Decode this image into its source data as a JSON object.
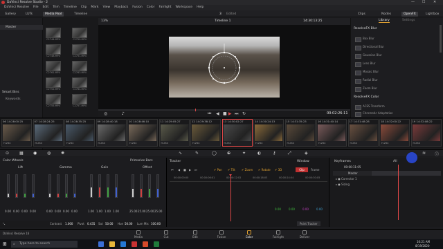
{
  "window": {
    "title": "DaVinci Resolve Studio - 2",
    "min": "—",
    "max": "☐",
    "close": "✕"
  },
  "menu": [
    "DaVinci Resolve",
    "File",
    "Edit",
    "Trim",
    "Timeline",
    "Clip",
    "Mark",
    "View",
    "Playback",
    "Fusion",
    "Color",
    "Fairlight",
    "Workspace",
    "Help"
  ],
  "toolbar": {
    "gallery": "Gallery",
    "luts": "LUTs",
    "media_pool": "Media Pool",
    "timeline": "Timeline",
    "project_num": "3",
    "project_status": "Edited",
    "clips": "Clips",
    "nodes": "Nodes",
    "openfx": "OpenFX",
    "lightbox": "Lightbox"
  },
  "left_panel": {
    "master": "Master",
    "smart_bins": "Smart Bins",
    "keywords": "Keywords"
  },
  "media_thumbs": [
    "C2744.MP4",
    "C2750.MP4",
    "C2748.MP4",
    "C2751.MP4",
    "C2761.MP4",
    "C2763.MP4",
    "C2752.MP4",
    "C2764.MP4",
    "C2755.MP4",
    "C2757.MP4"
  ],
  "viewer": {
    "zoom": "13%",
    "timeline_name": "Timeline 1",
    "timecode": "14:30:13:25",
    "playhead_tc": "00:02:26:11"
  },
  "library": {
    "tab_library": "Library",
    "tab_settings": "Settings",
    "blur_header": "ResolveFX Blur",
    "blur_items": [
      "Box Blur",
      "Directional Blur",
      "Gaussian Blur",
      "Lens Blur",
      "Mosaic Blur",
      "Radial Blur",
      "Zoom Blur"
    ],
    "color_header": "ResolveFX Color",
    "color_items": [
      "ACES Transform",
      "Chromatic Adaptation"
    ]
  },
  "clips": [
    {
      "num": "06",
      "tc": "14:28:00:25",
      "codec": "H.264",
      "color": "#6a5a4a"
    },
    {
      "num": "07",
      "tc": "14:28:24:25",
      "codec": "H.264",
      "color": "#5a6a7a"
    },
    {
      "num": "08",
      "tc": "14:28:35:25",
      "codec": "H.264",
      "color": "#4a5a6a"
    },
    {
      "num": "09",
      "tc": "14:28:40:18",
      "codec": "H.264",
      "color": "#6a6a6a"
    },
    {
      "num": "10",
      "tc": "14:28:46:10",
      "codec": "H.264",
      "color": "#7a6a5a"
    },
    {
      "num": "11",
      "tc": "14:29:05:27",
      "codec": "H.264",
      "color": "#5a5a4a"
    },
    {
      "num": "12",
      "tc": "14:29:38:12",
      "codec": "H.264",
      "color": "#6a5a3a"
    },
    {
      "num": "13",
      "tc": "14:30:02:27",
      "codec": "H.264",
      "color": "#4a4a4a"
    },
    {
      "num": "14",
      "tc": "14:30:24:13",
      "codec": "H.264",
      "color": "#8a6a3a"
    },
    {
      "num": "15",
      "tc": "14:31:35:23",
      "codec": "H.264",
      "color": "#5a4a3a"
    },
    {
      "num": "16",
      "tc": "14:31:40:14",
      "codec": "H.264",
      "color": "#7a5a5a"
    },
    {
      "num": "17",
      "tc": "14:31:48:28",
      "codec": "H.264",
      "color": "#6a5040"
    },
    {
      "num": "18",
      "tc": "14:32:00:22",
      "codec": "H.264",
      "color": "#8a4a3a"
    },
    {
      "num": "19",
      "tc": "14:32:08:22",
      "codec": "H.264",
      "color": "#7a3a3a"
    }
  ],
  "color_wheels": {
    "title": "Color Wheels",
    "primaries": "Primaries Bars",
    "groups": [
      {
        "name": "Lift",
        "vals": [
          "0.00",
          "0.00",
          "0.00",
          "0.00"
        ]
      },
      {
        "name": "Gamma",
        "vals": [
          "0.00",
          "0.00",
          "0.00",
          "0.00"
        ]
      },
      {
        "name": "Gain",
        "vals": [
          "1.00",
          "1.00",
          "1.00",
          "1.00"
        ]
      },
      {
        "name": "Offset",
        "vals": [
          "25.00",
          "25.00",
          "25.00",
          "25.00"
        ]
      }
    ],
    "contrast_label": "Contrast",
    "contrast": "1.000",
    "pivot_label": "Pivot",
    "pivot": "0.435",
    "sat_label": "Sat",
    "sat": "50.00",
    "hue_label": "Hue",
    "hue": "50.00",
    "lum_mix_label": "Lum Mix",
    "lum_mix": "100.00"
  },
  "tracker": {
    "title": "Tracker",
    "pan": "Pan",
    "tilt": "Tilt",
    "zoom": "Zoom",
    "rotate": "Rotate",
    "3d": "3D",
    "clip": "Clip",
    "frame": "Frame",
    "ticks": [
      "00:00:00:00",
      "00:00:06:01",
      "00:00:12:02",
      "00:00:18:03",
      "00:00:24:04",
      "00:00:30:05"
    ],
    "values": [
      "0.00",
      "0.00",
      "0.00",
      "0.00"
    ],
    "mode": "Point Tracker",
    "window_label": "Window"
  },
  "keyframes": {
    "title": "Keyframes",
    "all": "All",
    "tc": "00:00:11:05",
    "master": "Master",
    "corrector": "Corrector 1",
    "sizing": "Sizing"
  },
  "pages": [
    {
      "label": "Media",
      "active": false
    },
    {
      "label": "Cut",
      "active": false
    },
    {
      "label": "Edit",
      "active": false
    },
    {
      "label": "Fusion",
      "active": false
    },
    {
      "label": "Color",
      "active": true
    },
    {
      "label": "Fairlight",
      "active": false
    },
    {
      "label": "Deliver",
      "active": false
    }
  ],
  "app_footer": "DaVinci Resolve 16",
  "taskbar": {
    "search": "Type here to search",
    "time": "10:21 AM",
    "date": "8/19/2020"
  },
  "colors": {
    "accent": "#e0a030",
    "playhead": "#e04848",
    "highlight": "#2a49d8"
  }
}
